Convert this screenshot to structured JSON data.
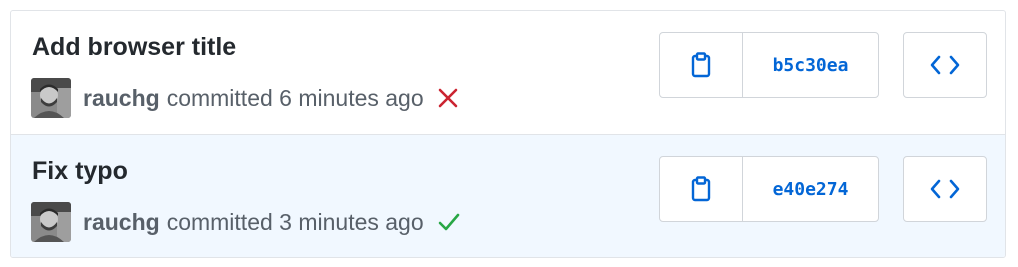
{
  "commits": [
    {
      "title": "Add browser title",
      "author": "rauchg",
      "committed_text": "committed 6 minutes ago",
      "status": "failure",
      "status_icon": "x-icon",
      "status_color": "#cb2431",
      "sha": "b5c30ea"
    },
    {
      "title": "Fix typo",
      "author": "rauchg",
      "committed_text": "committed 3 minutes ago",
      "status": "success",
      "status_icon": "check-icon",
      "status_color": "#28a745",
      "sha": "e40e274"
    }
  ],
  "colors": {
    "link": "#0366d6",
    "border": "#e1e4e8",
    "highlight_row": "#f1f8ff",
    "title": "#24292e",
    "meta": "#586069"
  }
}
